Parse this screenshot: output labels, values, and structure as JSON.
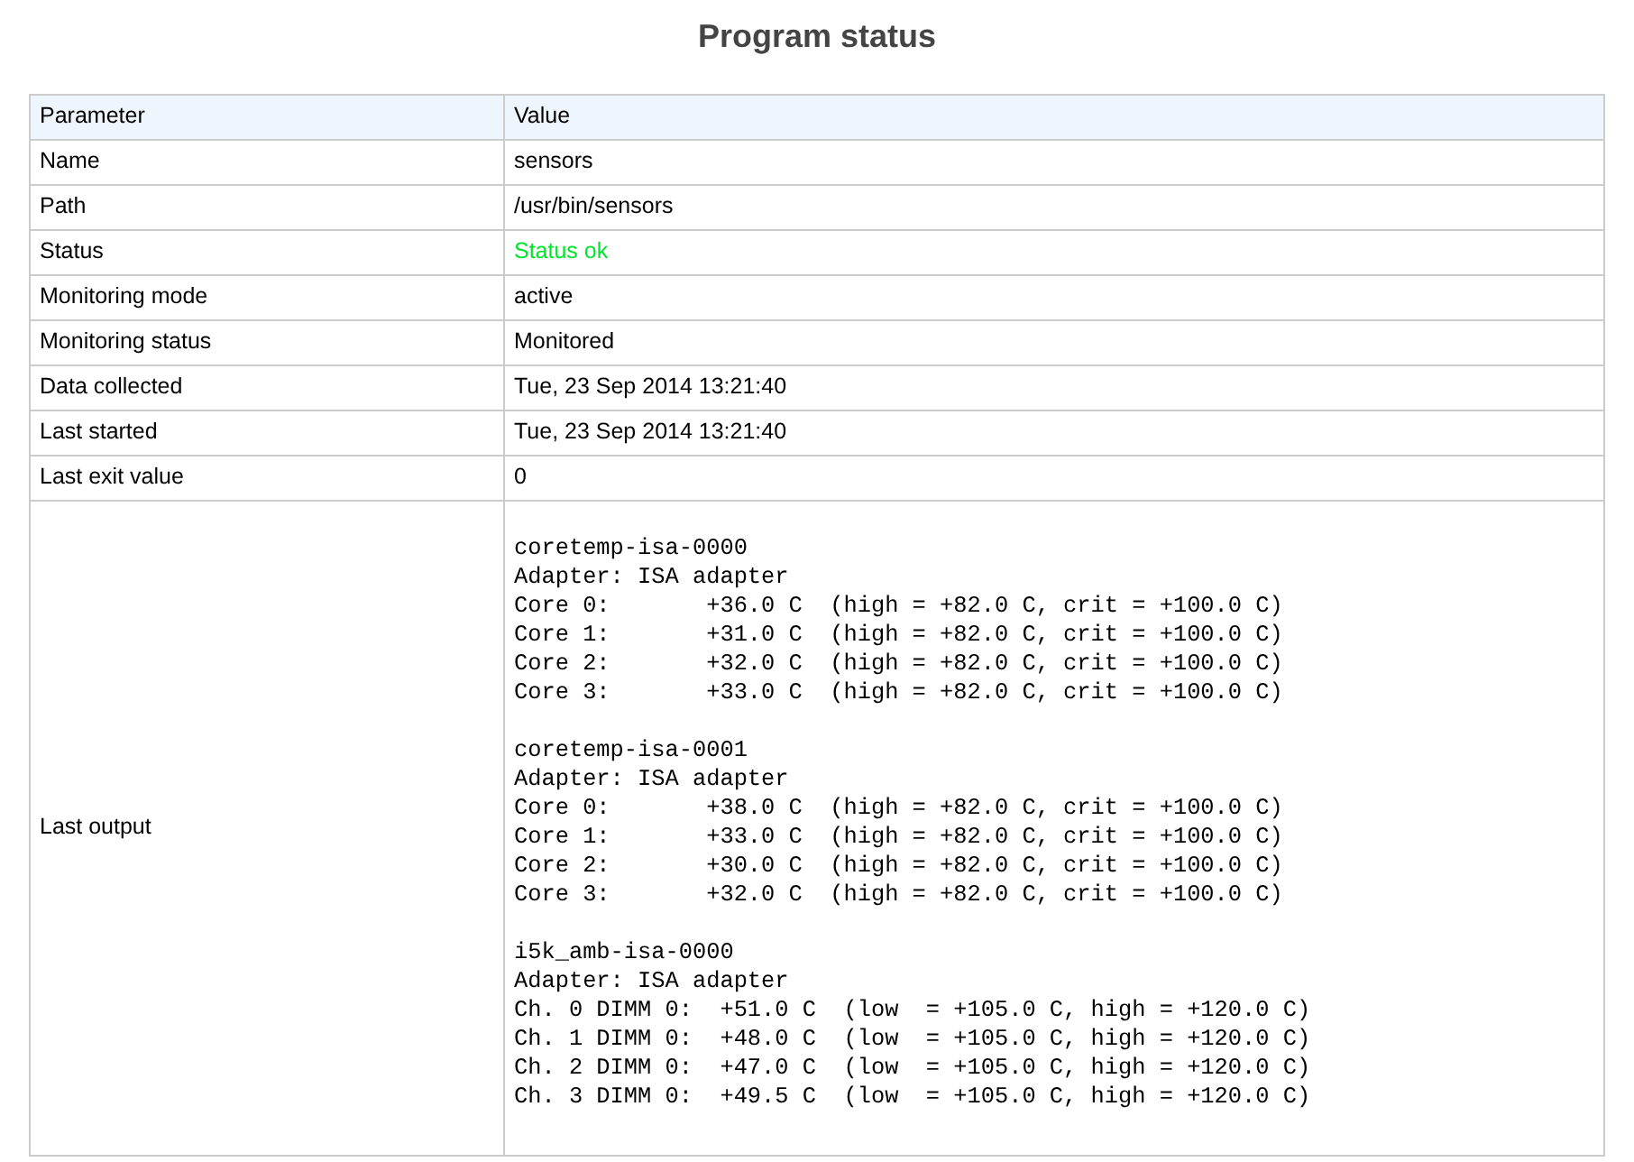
{
  "title": "Program status",
  "columns": [
    "Parameter",
    "Value"
  ],
  "rows": [
    {
      "parameter": "Name",
      "value": "sensors",
      "kind": "text"
    },
    {
      "parameter": "Path",
      "value": "/usr/bin/sensors",
      "kind": "text"
    },
    {
      "parameter": "Status",
      "value": "Status ok",
      "kind": "ok"
    },
    {
      "parameter": "Monitoring mode",
      "value": "active",
      "kind": "text"
    },
    {
      "parameter": "Monitoring status",
      "value": "Monitored",
      "kind": "text"
    },
    {
      "parameter": "Data collected",
      "value": "Tue, 23 Sep 2014 13:21:40",
      "kind": "text"
    },
    {
      "parameter": "Last started",
      "value": "Tue, 23 Sep 2014 13:21:40",
      "kind": "text"
    },
    {
      "parameter": "Last exit value",
      "value": "0",
      "kind": "text"
    },
    {
      "parameter": "Last output",
      "kind": "output",
      "output": [
        [
          "coretemp-isa-0000",
          "Adapter: ISA adapter",
          "Core 0:       +36.0 C  (high = +82.0 C, crit = +100.0 C)",
          "Core 1:       +31.0 C  (high = +82.0 C, crit = +100.0 C)",
          "Core 2:       +32.0 C  (high = +82.0 C, crit = +100.0 C)",
          "Core 3:       +33.0 C  (high = +82.0 C, crit = +100.0 C)"
        ],
        [
          "coretemp-isa-0001",
          "Adapter: ISA adapter",
          "Core 0:       +38.0 C  (high = +82.0 C, crit = +100.0 C)",
          "Core 1:       +33.0 C  (high = +82.0 C, crit = +100.0 C)",
          "Core 2:       +30.0 C  (high = +82.0 C, crit = +100.0 C)",
          "Core 3:       +32.0 C  (high = +82.0 C, crit = +100.0 C)"
        ],
        [
          "i5k_amb-isa-0000",
          "Adapter: ISA adapter",
          "Ch. 0 DIMM 0:  +51.0 C  (low  = +105.0 C, high = +120.0 C)",
          "Ch. 1 DIMM 0:  +48.0 C  (low  = +105.0 C, high = +120.0 C)",
          "Ch. 2 DIMM 0:  +47.0 C  (low  = +105.0 C, high = +120.0 C)",
          "Ch. 3 DIMM 0:  +49.5 C  (low  = +105.0 C, high = +120.0 C)"
        ]
      ]
    }
  ]
}
